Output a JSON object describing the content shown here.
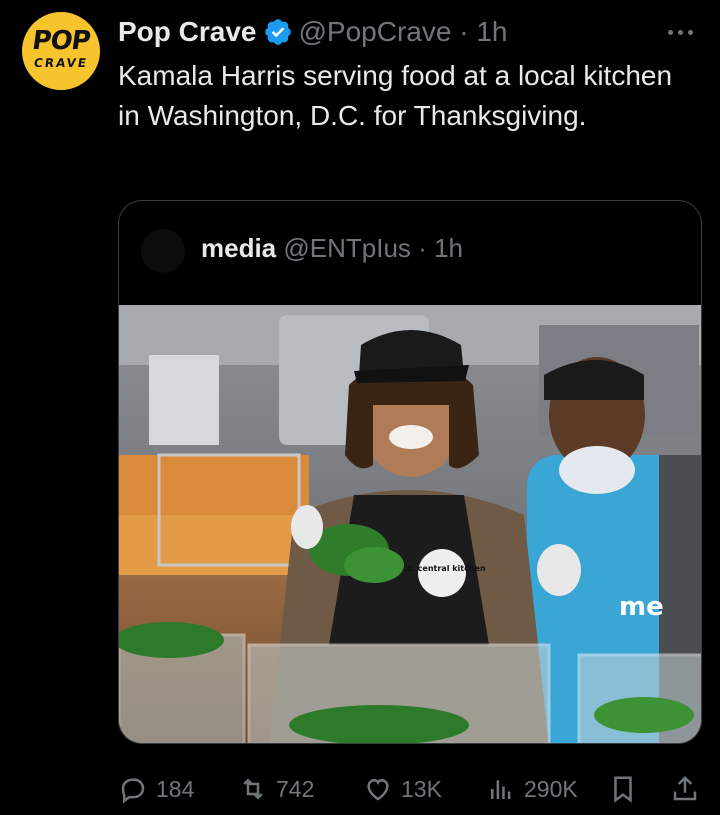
{
  "author": {
    "name": "Pop Crave",
    "handle": "@PopCrave",
    "time": "1h",
    "avatar_text_top": "POP",
    "avatar_text_bottom": "CRAVE"
  },
  "tweet_text": "Kamala Harris serving food at a local kitchen in Washington, D.C. for Thanksgiving.",
  "quoted": {
    "name": "media",
    "handle": "@ENTpIus",
    "time": "1h",
    "image_labels": {
      "apron_logo": "d.c. central kitchen",
      "shirt_text": "me"
    }
  },
  "actions": {
    "replies": "184",
    "reposts": "742",
    "likes": "13K",
    "views": "290K"
  },
  "colors": {
    "background": "#000000",
    "text": "#e7e9ea",
    "muted": "#71767b",
    "verified": "#1d9bf0",
    "avatar": "#f7c42d"
  }
}
